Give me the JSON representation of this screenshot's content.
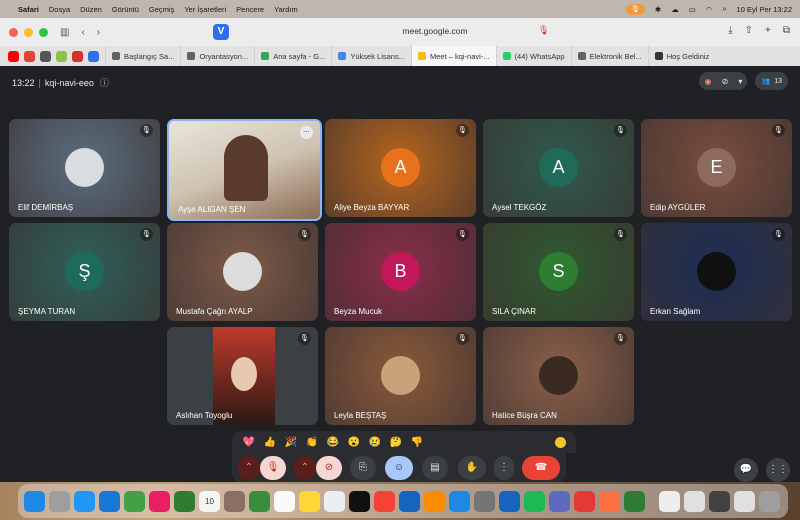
{
  "menubar": {
    "app": "Safari",
    "menus": [
      "Dosya",
      "Düzen",
      "Görüntü",
      "Geçmiş",
      "Yer İşaretleri",
      "Pencere",
      "Yardım"
    ],
    "datetime": "10 Eyl Per  13:22"
  },
  "browser": {
    "url": "meet.google.com",
    "tabs": [
      {
        "label": "Başlangıç Sa...",
        "color": "#5f6368"
      },
      {
        "label": "Oryantasyon...",
        "color": "#5f6368"
      },
      {
        "label": "Ana sayfa - G...",
        "color": "#34a853"
      },
      {
        "label": "Yüksek Lisans...",
        "color": "#4285f4"
      },
      {
        "label": "Meet – kqi-navi-...",
        "color": "#fbbc04"
      },
      {
        "label": "(44) WhatsApp",
        "color": "#25d366"
      },
      {
        "label": "Elektronik Bel...",
        "color": "#5f6368"
      },
      {
        "label": "Hoş Geldiniz",
        "color": "#333333"
      }
    ]
  },
  "meet": {
    "time": "13:22",
    "meeting_code": "kqi-navi-eeo",
    "participant_count": "13",
    "participants": [
      {
        "name": "Elif DEMİRBAŞ",
        "initial": "",
        "bg": "#5b6e7e",
        "avatar": "#d9dde0",
        "type": "photo",
        "mic": "muted"
      },
      {
        "name": "Ayşe ALIGAN ŞEN",
        "initial": "",
        "bg": "#d8d2c8",
        "avatar": "",
        "type": "video",
        "mic": "more"
      },
      {
        "name": "Aliye Beyza BAYYAR",
        "initial": "A",
        "bg": "#b5651d",
        "avatar": "#e8711c",
        "type": "initial",
        "mic": "muted"
      },
      {
        "name": "Aysel TEKGÖZ",
        "initial": "A",
        "bg": "#2f5a4c",
        "avatar": "#1f6b57",
        "type": "initial",
        "mic": "muted"
      },
      {
        "name": "Edip AYGÜLER",
        "initial": "E",
        "bg": "#7a4e3c",
        "avatar": "#8d6a5e",
        "type": "initial",
        "mic": "muted"
      },
      {
        "name": "ŞEYMA TURAN",
        "initial": "Ş",
        "bg": "#2e6058",
        "avatar": "#1e6b5c",
        "type": "initial",
        "mic": "muted"
      },
      {
        "name": "Mustafa Çağrı AYALP",
        "initial": "",
        "bg": "#7d5a48",
        "avatar": "#dcdcdc",
        "type": "photo",
        "mic": "muted"
      },
      {
        "name": "Beyza Mucuk",
        "initial": "B",
        "bg": "#8a2d48",
        "avatar": "#c2185b",
        "type": "initial",
        "mic": "muted"
      },
      {
        "name": "SILA ÇINAR",
        "initial": "S",
        "bg": "#2f5a30",
        "avatar": "#2e7d32",
        "type": "initial",
        "mic": "muted"
      },
      {
        "name": "Erkan Sağlam",
        "initial": "",
        "bg": "#1c2e55",
        "avatar": "#111111",
        "type": "photo",
        "mic": "muted"
      },
      {
        "name": "Aslıhan Toyoglu",
        "initial": "",
        "bg": "#3c4043",
        "avatar": "",
        "type": "video",
        "mic": "muted"
      },
      {
        "name": "Leyla BEŞTAŞ",
        "initial": "",
        "bg": "#8a5a3a",
        "avatar": "#c9a27a",
        "type": "photo",
        "mic": "muted"
      },
      {
        "name": "Hatice Büşra CAN",
        "initial": "",
        "bg": "#8a6048",
        "avatar": "#3a2a22",
        "type": "photo",
        "mic": "muted"
      }
    ],
    "reactions": [
      "💖",
      "👍",
      "🎉",
      "👏",
      "😂",
      "😮",
      "😢",
      "🤔",
      "👎"
    ]
  }
}
